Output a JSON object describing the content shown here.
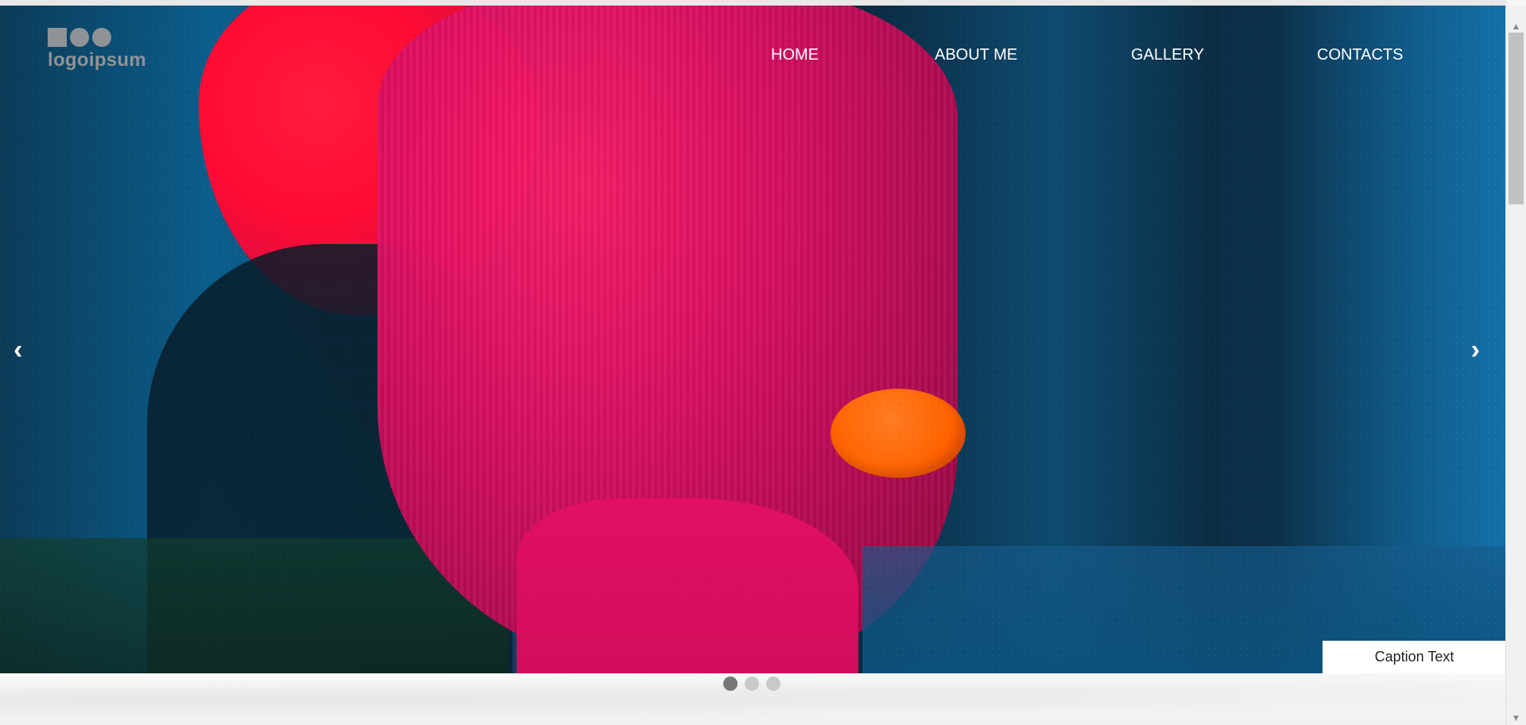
{
  "logo": {
    "text": "logoipsum"
  },
  "nav": {
    "items": [
      {
        "label": "HOME"
      },
      {
        "label": "ABOUT ME"
      },
      {
        "label": "GALLERY"
      },
      {
        "label": "CONTACTS"
      }
    ]
  },
  "slider": {
    "caption": "Caption Text",
    "prev_arrow": "‹",
    "next_arrow": "›",
    "dots": [
      {
        "state": "active"
      },
      {
        "state": "inactive"
      },
      {
        "state": "inactive"
      }
    ],
    "colors": {
      "blue": "#0b5d8b",
      "dark_blue": "#091d2d",
      "red": "#ff0b33",
      "magenta": "#e20f63",
      "orange": "#ff6200"
    }
  },
  "scrollbar": {
    "up_icon": "▲",
    "down_icon": "▼"
  },
  "icons": {
    "prev": "chevron-left-icon",
    "next": "chevron-right-icon",
    "scroll_up": "arrow-up-icon",
    "scroll_down": "arrow-down-icon"
  }
}
